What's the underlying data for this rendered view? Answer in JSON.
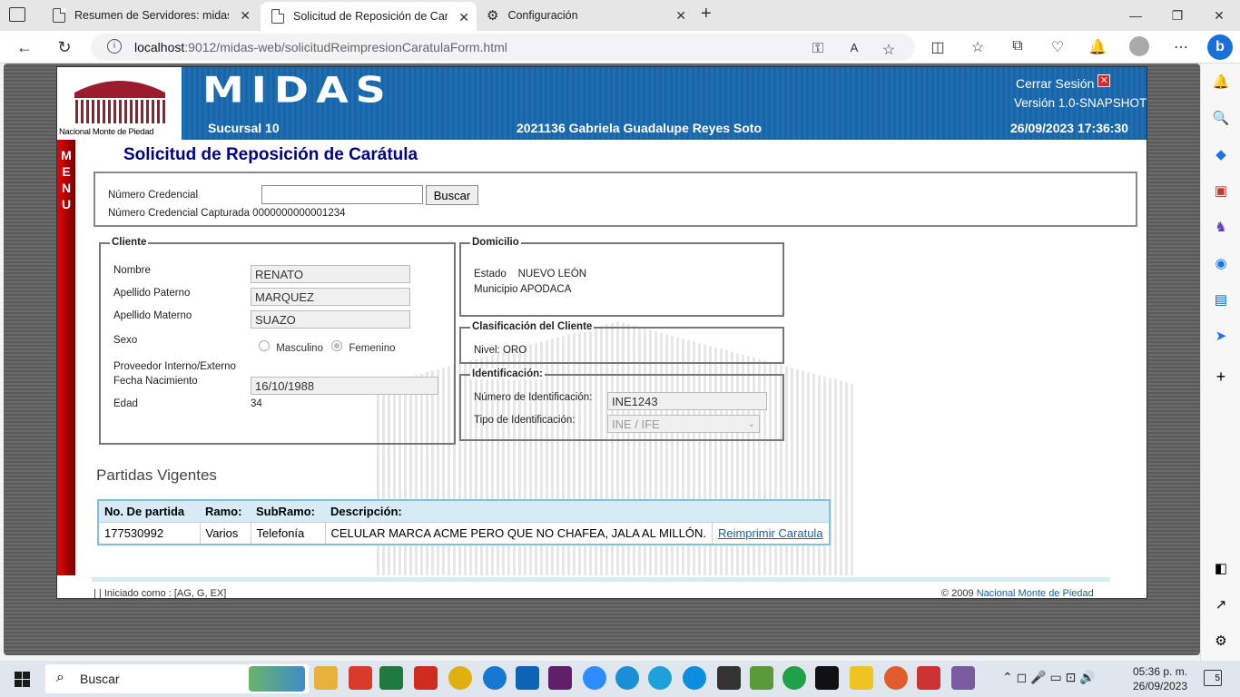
{
  "browser": {
    "tabs": [
      {
        "title": "Resumen de Servidores: midas_d",
        "active": false
      },
      {
        "title": "Solicitud de Reposición de Carátu",
        "active": true
      },
      {
        "title": "Configuración",
        "active": false
      }
    ],
    "url_host": "localhost",
    "url_rest": ":9012/midas-web/solicitudReimpresionCaratulaForm.html"
  },
  "header": {
    "logo_text": "Nacional Monte de Piedad",
    "app_name": "MIDAS",
    "logout_label": "Cerrar Sesión",
    "version": "Versión 1.0-SNAPSHOT",
    "branch": "Sucursal 10",
    "user": "2021136 Gabriela Guadalupe Reyes Soto",
    "datetime": "26/09/2023 17:36:30"
  },
  "menu_label": "MENU",
  "page_title": "Solicitud de Reposición de Carátula",
  "search": {
    "credential_label": "Número Credencial",
    "credential_value": "",
    "search_button": "Buscar",
    "captured_label": "Número Credencial Capturada",
    "captured_value": "0000000000001234"
  },
  "cliente": {
    "legend": "Cliente",
    "nombre_label": "Nombre",
    "nombre": "RENATO",
    "paterno_label": "Apellido Paterno",
    "paterno": "MARQUEZ",
    "materno_label": "Apellido Materno",
    "materno": "SUAZO",
    "sexo_label": "Sexo",
    "masculino": "Masculino",
    "femenino": "Femenino",
    "proveedor_label": "Proveedor Interno/Externo",
    "fecha_label": "Fecha Nacimiento",
    "fecha": "16/10/1988",
    "edad_label": "Edad",
    "edad": "34"
  },
  "domicilio": {
    "legend": "Domicilio",
    "estado_label": "Estado",
    "estado": "NUEVO LEÓN",
    "municipio_label": "Municipio",
    "municipio": "APODACA"
  },
  "clasificacion": {
    "legend": "Clasificación del Cliente",
    "nivel_label": "Nivel:",
    "nivel": "ORO"
  },
  "identificacion": {
    "legend": "Identificación:",
    "numero_label": "Número de Identificación:",
    "numero": "INE1243",
    "tipo_label": "Tipo de Identificación:",
    "tipo": "INE / IFE"
  },
  "partidas": {
    "title": "Partidas Vigentes",
    "headers": [
      "No. De partida",
      "Ramo:",
      "SubRamo:",
      "Descripción:"
    ],
    "rows": [
      {
        "partida": "177530992",
        "ramo": "Varios",
        "subramo": "Telefonía",
        "descripcion": "CELULAR MARCA ACME PERO QUE NO CHAFEA, JALA AL MILLÓN.",
        "action": "Reimprimir Caratula"
      }
    ]
  },
  "footer": {
    "left": "| | Iniciado como : [AG, G, EX]",
    "copyright": "© 2009",
    "link": "Nacional Monte de Piedad"
  },
  "taskbar": {
    "search": "Buscar",
    "time": "05:36 p. m.",
    "date": "26/09/2023",
    "notif": "5"
  }
}
